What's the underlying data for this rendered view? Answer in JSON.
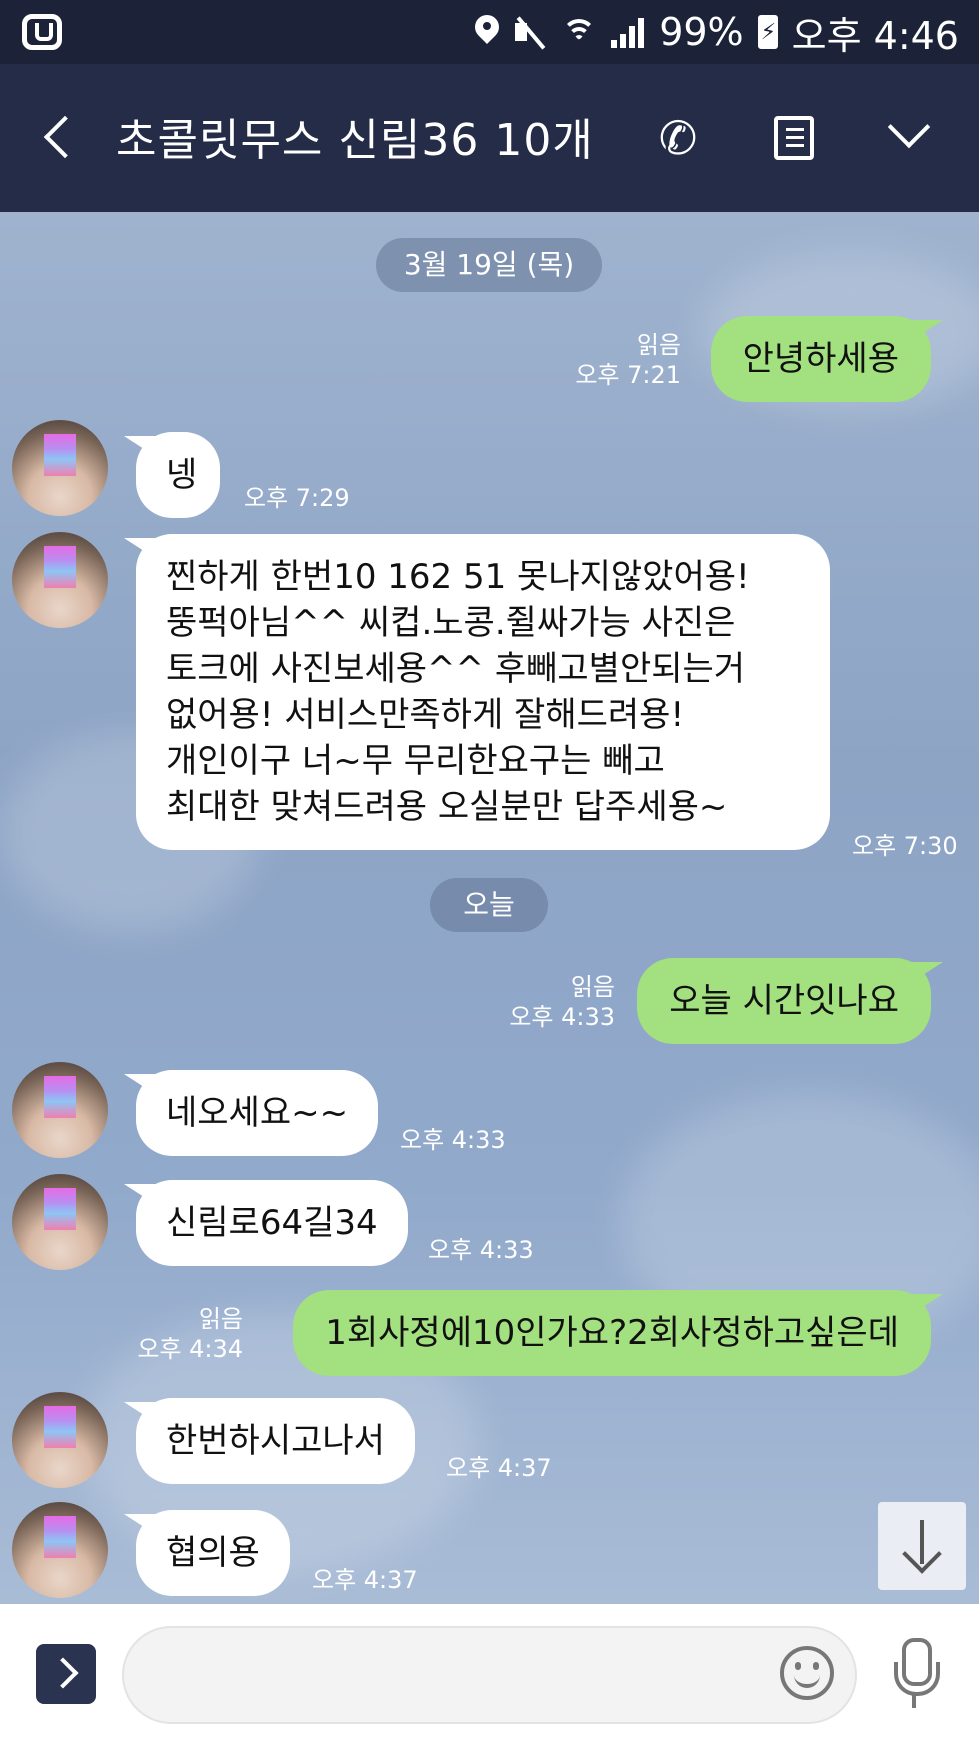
{
  "status_bar": {
    "battery": "99%",
    "time": "오후 4:46"
  },
  "header": {
    "title": "초콜릿무스 신림36 10개"
  },
  "dates": {
    "first": "3월 19일 (목)",
    "today": "오늘"
  },
  "messages": [
    {
      "side": "out",
      "text": "안녕하세용",
      "read": "읽음",
      "time": "오후 7:21"
    },
    {
      "side": "in",
      "text": "넹",
      "time": "오후 7:29"
    },
    {
      "side": "in",
      "text": "찐하게 한번10   162  51 못나지않았어용!\n뚱퍽아님^^ 씨컵.노콩.쥘싸가능 사진은\n토크에 사진보세용^^ 후빼고별안되는거\n없어용! 서비스만족하게 잘해드려용!\n개인이구  너~무 무리한요구는 빼고\n최대한 맞쳐드려용 오실분만 답주세용~",
      "time": "오후 7:30"
    },
    {
      "side": "out",
      "text": "오늘 시간잇나요",
      "read": "읽음",
      "time": "오후 4:33"
    },
    {
      "side": "in",
      "text": "네오세요~~",
      "time": "오후 4:33"
    },
    {
      "side": "in",
      "text": "신림로64길34",
      "time": "오후 4:33"
    },
    {
      "side": "out",
      "text": "1회사정에10인가요?2회사정하고싶은데",
      "read": "읽음",
      "time": "오후 4:34"
    },
    {
      "side": "in",
      "text": "한번하시고나서",
      "time": "오후 4:37"
    },
    {
      "side": "in",
      "text": "협의용",
      "time": "오후 4:37"
    }
  ],
  "input": {
    "placeholder": ""
  },
  "icons": {
    "back": "back-arrow-icon",
    "phone": "phone-icon",
    "menu": "document-menu-icon",
    "expand": "chevron-down-icon",
    "scroll": "arrow-down-icon",
    "plus": "chevron-right-icon",
    "emoji": "emoji-icon",
    "mic": "microphone-icon"
  },
  "colors": {
    "header": "#242c47",
    "outgoing_bubble": "#a3e07f",
    "incoming_bubble": "#ffffff",
    "chat_bg": "#8ea4c4"
  }
}
